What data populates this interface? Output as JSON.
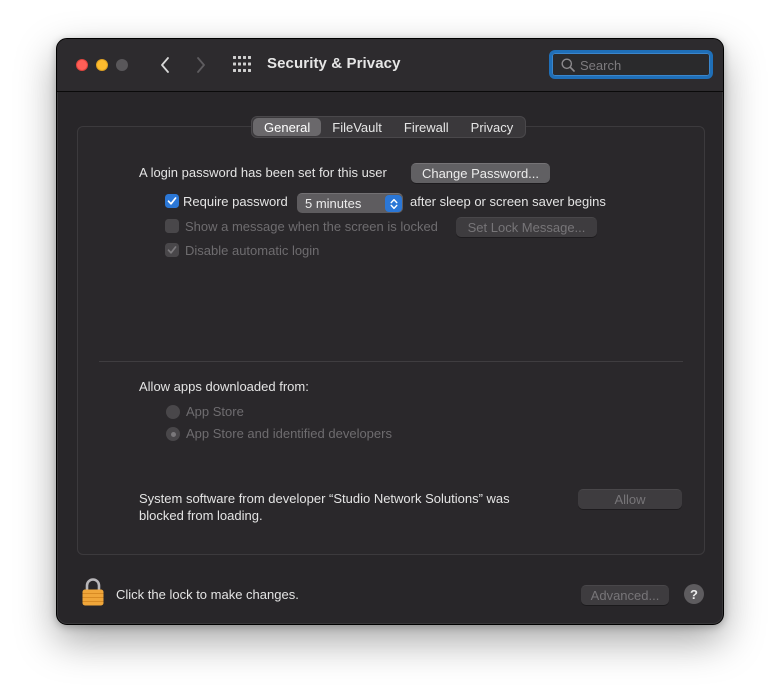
{
  "window": {
    "title": "Security & Privacy"
  },
  "search": {
    "placeholder": "Search",
    "value": ""
  },
  "icons": {
    "close": "close-icon",
    "minimize": "minimize-icon",
    "zoom": "zoom-icon",
    "back": "chevron-left-icon",
    "forward": "chevron-right-icon",
    "show_all": "grid-icon",
    "search": "search-icon",
    "lock": "lock-icon",
    "help": "question-icon"
  },
  "tabs": [
    {
      "label": "General",
      "active": true
    },
    {
      "label": "FileVault",
      "active": false
    },
    {
      "label": "Firewall",
      "active": false
    },
    {
      "label": "Privacy",
      "active": false
    }
  ],
  "general": {
    "login_password_text": "A login password has been set for this user",
    "change_password_label": "Change Password...",
    "require_password_label": "Require password",
    "require_password_checked": true,
    "require_password_delay": "5 minutes",
    "require_password_suffix": "after sleep or screen saver begins",
    "show_message_label": "Show a message when the screen is locked",
    "show_message_checked": false,
    "set_lock_message_label": "Set Lock Message...",
    "disable_auto_login_label": "Disable automatic login",
    "disable_auto_login_checked": true
  },
  "downloads": {
    "heading": "Allow apps downloaded from:",
    "options": [
      {
        "label": "App Store",
        "selected": false
      },
      {
        "label": "App Store and identified developers",
        "selected": true
      }
    ]
  },
  "blocked": {
    "line1": "System software from developer “Studio Network Solutions” was",
    "line2": "blocked from loading.",
    "allow_label": "Allow"
  },
  "footer": {
    "lock_text": "Click the lock to make changes.",
    "advanced_label": "Advanced...",
    "help_label": "?"
  },
  "colors": {
    "accent": "#2b77d6",
    "window_bg": "#282629",
    "close": "#ff5f57",
    "minimize": "#febc2e",
    "lock": "#f0a63a"
  }
}
